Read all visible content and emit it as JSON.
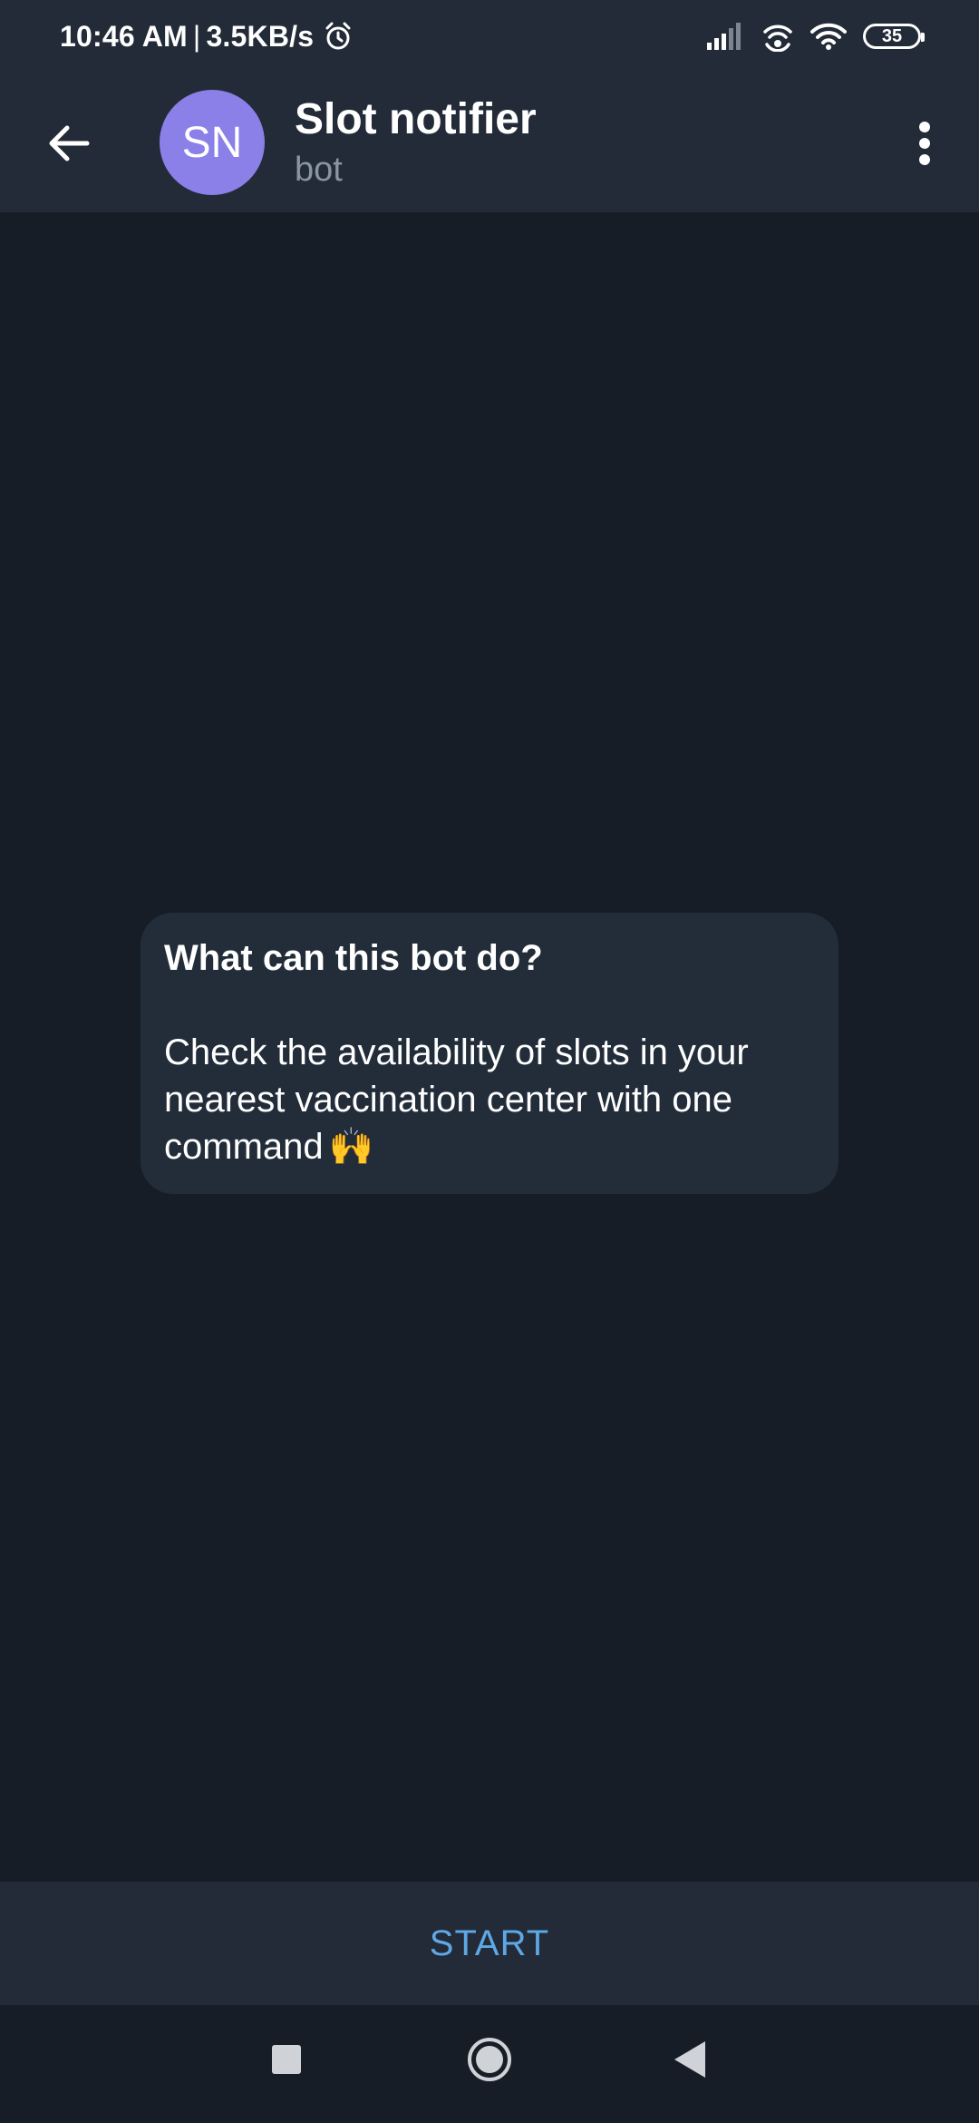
{
  "status_bar": {
    "time": "10:46 AM",
    "separator": "|",
    "speed": "3.5KB/s",
    "battery": "35"
  },
  "header": {
    "avatar_initials": "SN",
    "avatar_color": "#8b7fe8",
    "title": "Slot notifier",
    "subtitle": "bot"
  },
  "bot_info": {
    "title": "What can this bot do?",
    "description": "Check the availability of slots in your nearest vaccination center with one command",
    "emoji": "🙌"
  },
  "start_button": {
    "label": "START",
    "color": "#5fa8e6"
  },
  "icons": {
    "back": "arrow-left-icon",
    "menu": "more-vert-icon",
    "alarm": "alarm-icon",
    "signal": "signal-icon",
    "hotspot": "hotspot-icon",
    "wifi": "wifi-icon",
    "nav_recents": "square-icon",
    "nav_home": "circle-icon",
    "nav_back": "triangle-icon"
  }
}
